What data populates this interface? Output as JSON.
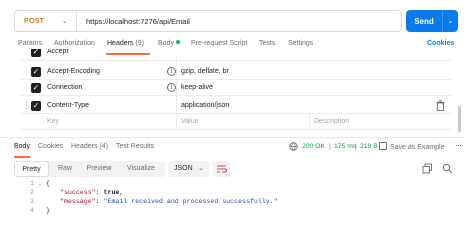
{
  "request": {
    "method": "POST",
    "url": "https://localhost:7276/api/Email",
    "send_label": "Send"
  },
  "request_tabs": [
    {
      "label": "Params"
    },
    {
      "label": "Authorization"
    },
    {
      "label": "Headers",
      "count": "(9)"
    },
    {
      "label": "Body"
    },
    {
      "label": "Pre-request Script"
    },
    {
      "label": "Tests"
    },
    {
      "label": "Settings"
    }
  ],
  "cookies_label": "Cookies",
  "headers_table": {
    "rows": [
      {
        "key": "Accept",
        "value": ""
      },
      {
        "key": "Accept-Encoding",
        "value": "gzip, deflate, br"
      },
      {
        "key": "Connection",
        "value": "keep-alive"
      },
      {
        "key": "Content-Type",
        "value": "application/json"
      }
    ],
    "placeholder": {
      "key": "Key",
      "value": "Value",
      "description": "Description"
    }
  },
  "response_tabs": [
    {
      "label": "Body"
    },
    {
      "label": "Cookies"
    },
    {
      "label": "Headers",
      "count": "(4)"
    },
    {
      "label": "Test Results"
    }
  ],
  "response_status": {
    "code": "200 OK",
    "time": "175 ms",
    "size": "219 B"
  },
  "save_example_label": "Save as Example",
  "toolbar": {
    "views": [
      "Pretty",
      "Raw",
      "Preview",
      "Visualize"
    ],
    "active_view": "Pretty",
    "format": "JSON"
  },
  "response_body": {
    "line_numbers": [
      "1",
      "2",
      "3",
      "4"
    ],
    "lines": [
      {
        "text": "{"
      },
      {
        "key": "\"success\"",
        "value": "true",
        "suffix": ","
      },
      {
        "key": "\"message\"",
        "value": "\"Email received and processed successfully.\"",
        "suffix": ""
      },
      {
        "text": "}"
      }
    ]
  },
  "colors": {
    "accent": "#ff6c37",
    "send": "#097bed",
    "method": "#d67b24",
    "status_ok": "#0a9c3c"
  }
}
